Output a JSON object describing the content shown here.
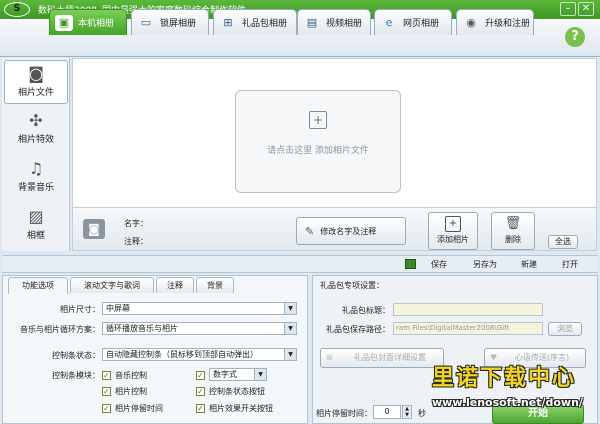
{
  "window": {
    "title": "数码大师2008",
    "slogan": "国内最强大的家庭数码综合制作软件",
    "logo_text": "S"
  },
  "tabs": [
    {
      "label": "本机相册",
      "icon": "photo-album-icon"
    },
    {
      "label": "锁屏相册",
      "icon": "monitor-icon"
    },
    {
      "label": "礼品包相册",
      "icon": "gift-icon"
    },
    {
      "label": "视频相册",
      "icon": "film-icon"
    },
    {
      "label": "网页相册",
      "icon": "browser-icon"
    },
    {
      "label": "升级和注册",
      "icon": "upgrade-icon"
    }
  ],
  "help_label": "?",
  "sidebar": [
    {
      "label": "相片文件",
      "icon": "camera-icon"
    },
    {
      "label": "相片特效",
      "icon": "effects-icon"
    },
    {
      "label": "背景音乐",
      "icon": "music-note-icon"
    },
    {
      "label": "相框",
      "icon": "picture-frame-icon"
    }
  ],
  "canvas": {
    "hint": "请点击这里  添加相片文件"
  },
  "info": {
    "name_label": "名字：",
    "note_label": "注释：",
    "edit_button": "修改名字及注释",
    "add_button": "添加相片",
    "delete_button": "删除",
    "select_all": "全选"
  },
  "toolbar": {
    "save": "保存",
    "save_as": "另存为",
    "new": "新建",
    "open": "打开"
  },
  "panel_tabs": [
    "功能选项",
    "滚动文字与歌词",
    "注释",
    "背景"
  ],
  "options": {
    "size_label": "相片尺寸：",
    "size_value": "中屏幕",
    "loop_label": "音乐与相片循环方案：",
    "loop_value": "循环播放音乐与相片",
    "control_label": "控制条状态：",
    "control_value": "自动隐藏控制条（鼠标移到顶部自动弹出）",
    "module_label": "控制条模块：",
    "checks": [
      {
        "label": "音乐控制",
        "checked": true
      },
      {
        "label": "数字式",
        "checked": true,
        "is_select": true
      },
      {
        "label": "相片控制",
        "checked": true
      },
      {
        "label": "控制条状态按钮",
        "checked": true
      },
      {
        "label": "相片停留时间",
        "checked": true
      },
      {
        "label": "相片效果开关按钮",
        "checked": true
      }
    ]
  },
  "gift": {
    "title": "礼品包专项设置：",
    "title_label": "礼品包标题：",
    "path_label": "礼品包保存路径：",
    "path_value": "ram Files\\DigitalMaster2008\\Gift",
    "browse": "浏览",
    "cover_button": "礼品包封面详细设置",
    "card_button": "心语传送(序言)",
    "stay_label": "相片停留时间：",
    "stay_value": "0",
    "stay_unit": "秒",
    "start_button": "开始"
  },
  "watermark": {
    "text": "里诺下载中心",
    "url": "www.lenosoft.net/down/"
  }
}
